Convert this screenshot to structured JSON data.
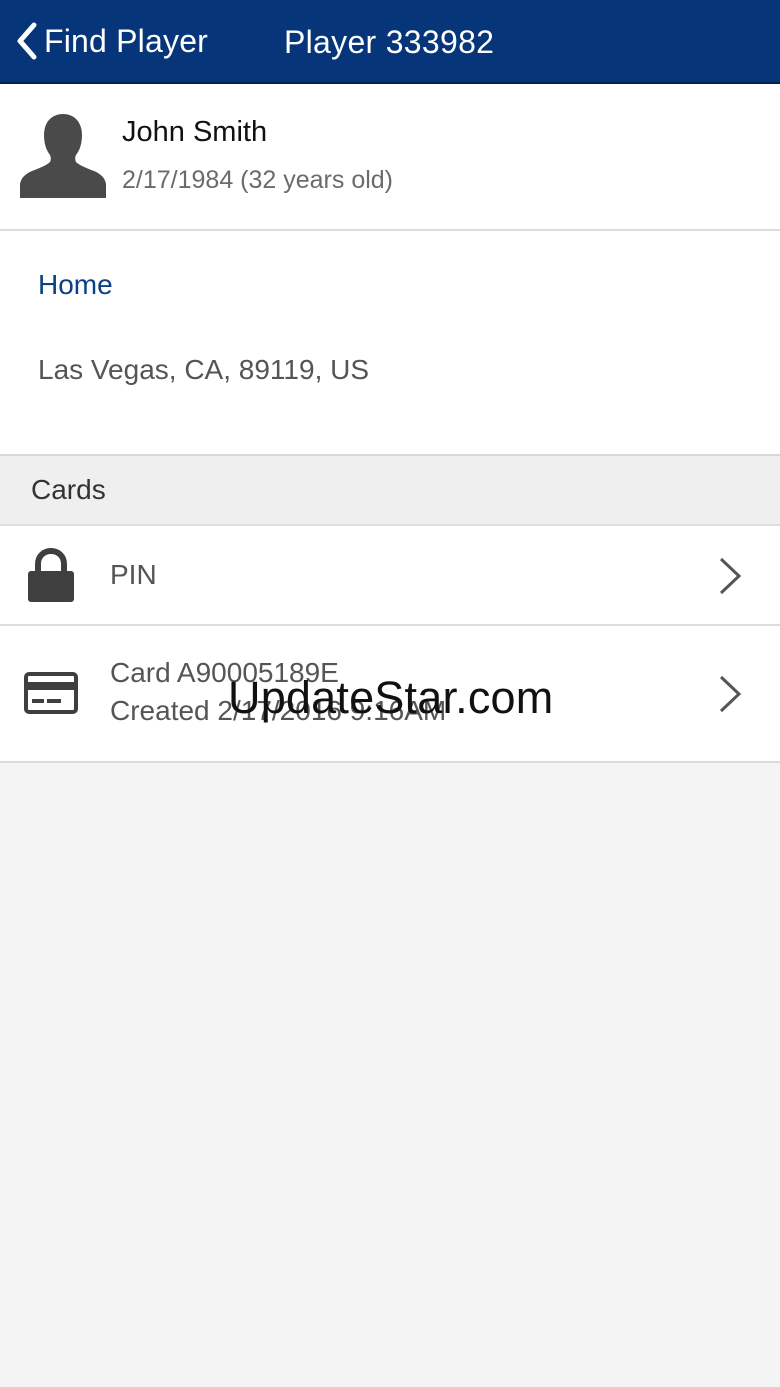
{
  "navbar": {
    "back_label": "Find Player",
    "title": "Player 333982",
    "background_color": "#06357a"
  },
  "profile": {
    "avatar_icon": "person-silhouette-icon",
    "name": "John Smith",
    "dob": "2/17/1984 (32 years old)"
  },
  "address": {
    "type": "Home",
    "line": "Las Vegas, CA, 89119, US"
  },
  "cards_section": {
    "header": "Cards",
    "rows": [
      {
        "icon": "lock-icon",
        "label": "PIN"
      },
      {
        "icon": "credit-card-icon",
        "line1": "Card A90005189E",
        "line2": "Created 2/17/2016 9:16AM"
      }
    ]
  },
  "watermark": "UpdateStar.com"
}
